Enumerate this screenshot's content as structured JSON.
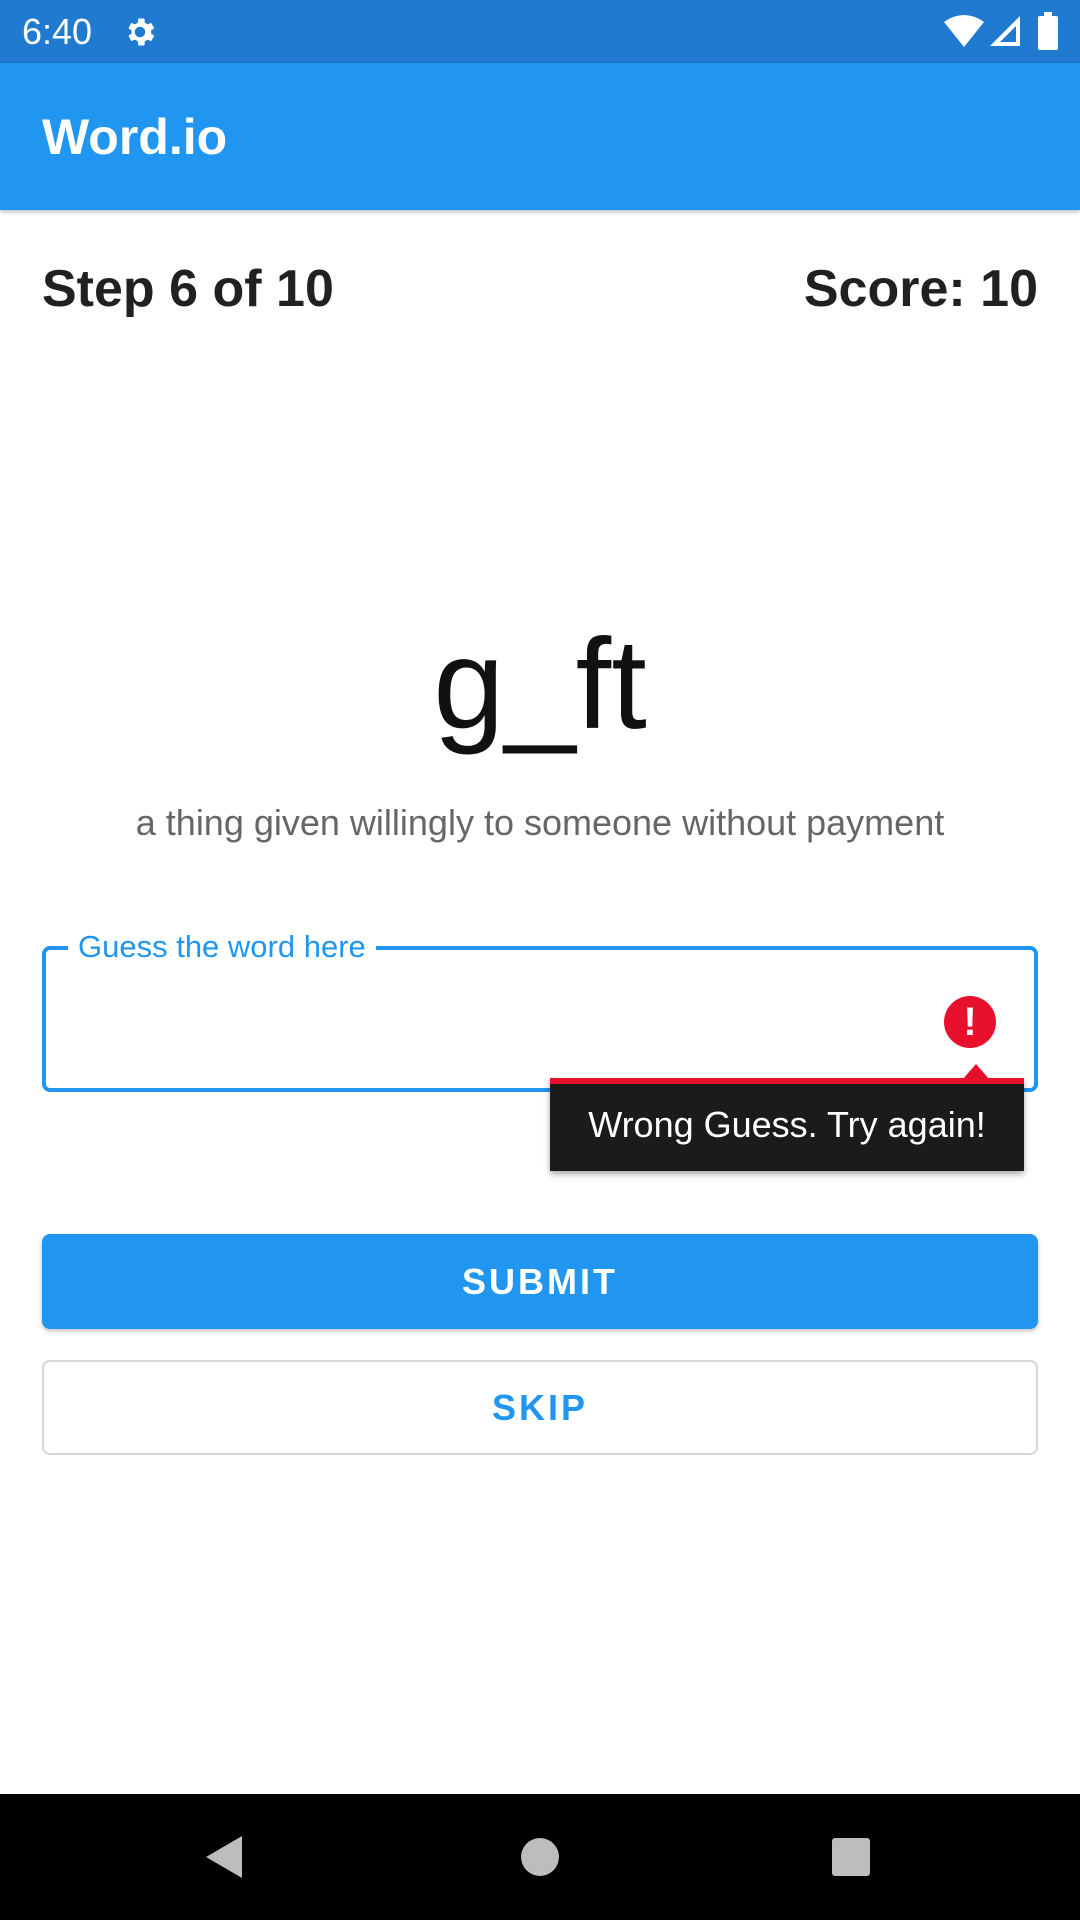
{
  "status_bar": {
    "time": "6:40",
    "icons": [
      "gear-icon",
      "wifi-icon",
      "signal-icon",
      "battery-icon"
    ]
  },
  "app_bar": {
    "title": "Word.io"
  },
  "game": {
    "step": "Step 6 of 10",
    "score": "Score: 10",
    "word": "g_ft",
    "hint": "a thing given willingly to someone without payment"
  },
  "guess_field": {
    "label": "Guess the word here",
    "value": "",
    "error_icon": "error-icon",
    "error_message": "Wrong Guess. Try again!"
  },
  "buttons": {
    "submit": "SUBMIT",
    "skip": "SKIP"
  },
  "nav_bar": {
    "icons": [
      "back-icon",
      "home-icon",
      "recents-icon"
    ]
  },
  "colors": {
    "status_bar": "#1f7ad0",
    "primary": "#2196f0",
    "error": "#e8102c",
    "tooltip": "#1b1b1b"
  }
}
